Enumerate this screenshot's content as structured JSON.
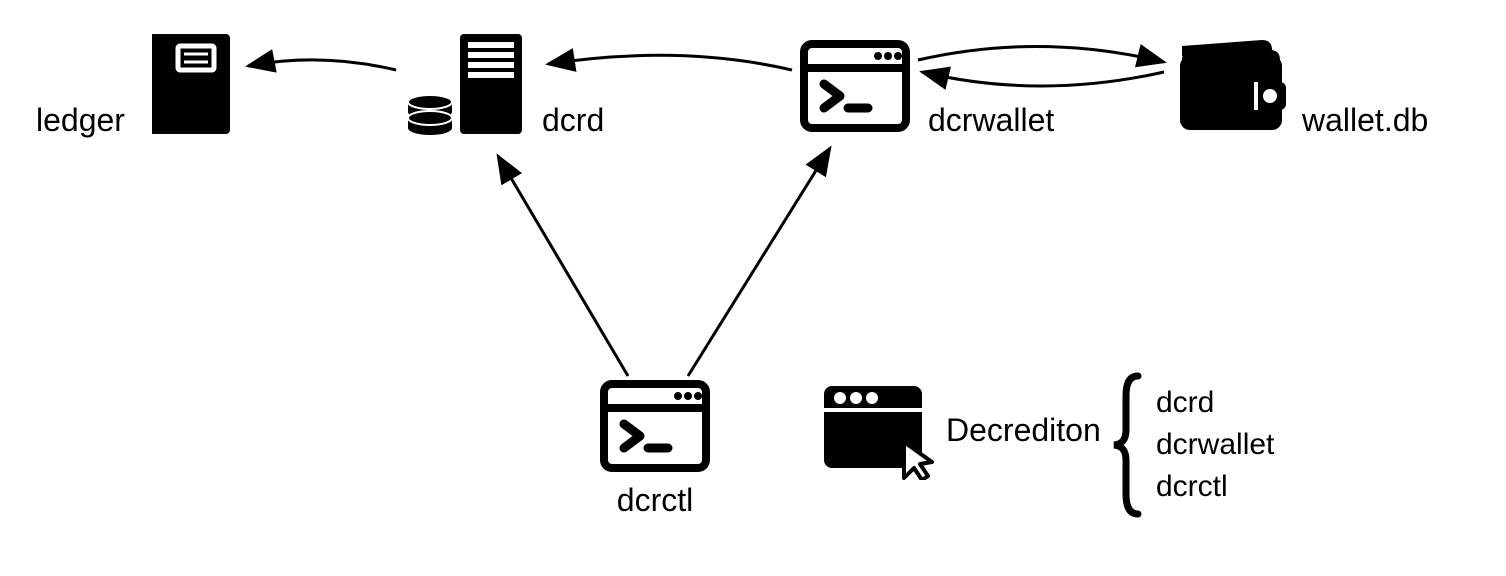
{
  "diagram": {
    "nodes": {
      "ledger": {
        "label": "ledger"
      },
      "dcrd": {
        "label": "dcrd"
      },
      "dcrwallet": {
        "label": "dcrwallet"
      },
      "walletdb": {
        "label": "wallet.db"
      },
      "dcrctl": {
        "label": "dcrctl"
      },
      "decrediton": {
        "label": "Decrediton"
      }
    },
    "decrediton_bundle": {
      "items": [
        "dcrd",
        "dcrwallet",
        "dcrctl"
      ]
    },
    "edges": [
      {
        "from": "dcrd",
        "to": "ledger",
        "bidirectional": false
      },
      {
        "from": "dcrwallet",
        "to": "dcrd",
        "bidirectional": false
      },
      {
        "from": "dcrwallet",
        "to": "walletdb",
        "bidirectional": true
      },
      {
        "from": "dcrctl",
        "to": "dcrd",
        "bidirectional": false
      },
      {
        "from": "dcrctl",
        "to": "dcrwallet",
        "bidirectional": false
      }
    ]
  }
}
